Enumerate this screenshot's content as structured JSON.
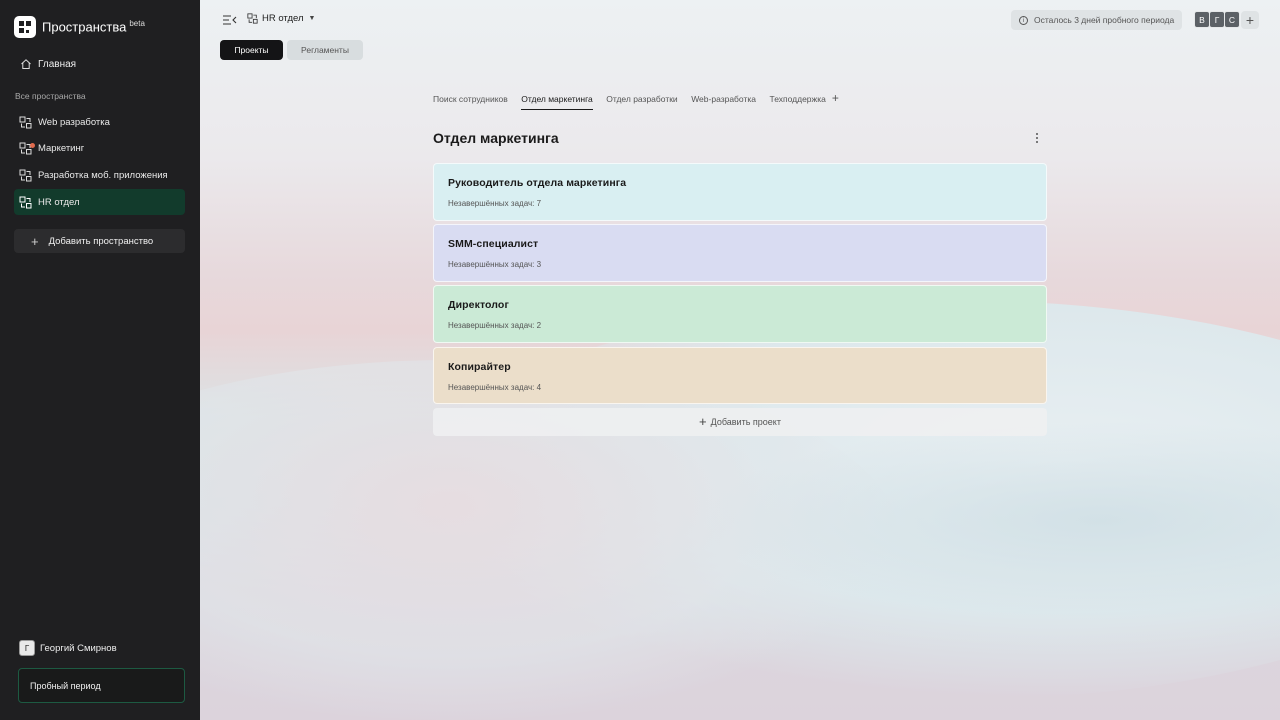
{
  "app": {
    "title": "Пространства",
    "badge": "beta"
  },
  "sidebar": {
    "home_label": "Главная",
    "section_label": "Все пространства",
    "spaces": [
      {
        "label": "Web разработка",
        "active": false,
        "notification": false
      },
      {
        "label": "Маркетинг",
        "active": false,
        "notification": true
      },
      {
        "label": "Разработка моб. приложения",
        "active": false,
        "notification": false
      },
      {
        "label": "HR отдел",
        "active": true,
        "notification": false
      }
    ],
    "add_space_label": "Добавить пространство",
    "user": {
      "initial": "Г",
      "name": "Георгий Смирнов"
    },
    "trial_label": "Пробный период"
  },
  "header": {
    "breadcrumb": "HR отдел",
    "trial_notice": "Осталось 3 дней пробного периода",
    "members": [
      "В",
      "Г",
      "С"
    ]
  },
  "segments": {
    "projects": "Проекты",
    "regulations": "Регламенты"
  },
  "tabs": [
    "Поиск сотрудников",
    "Отдел маркетинга",
    "Отдел разработки",
    "Web-разработка",
    "Техподдержка"
  ],
  "active_tab_index": 1,
  "page": {
    "title": "Отдел маркетинга"
  },
  "projects": [
    {
      "title": "Руководитель отдела маркетинга",
      "subtitle": "Незавершённых задач: 7",
      "color": "#d9eff2"
    },
    {
      "title": "SMM-специалист",
      "subtitle": "Незавершённых задач: 3",
      "color": "#d9dcf2"
    },
    {
      "title": "Директолог",
      "subtitle": "Незавершённых задач: 2",
      "color": "#cbead6"
    },
    {
      "title": "Копирайтер",
      "subtitle": "Незавершённых задач: 4",
      "color": "#ebdeca"
    }
  ],
  "add_project_label": "Добавить проект",
  "colors": {
    "sidebar_bg": "#1f1f21",
    "active_space_bg": "#123b2c",
    "primary_button": "#141416"
  }
}
